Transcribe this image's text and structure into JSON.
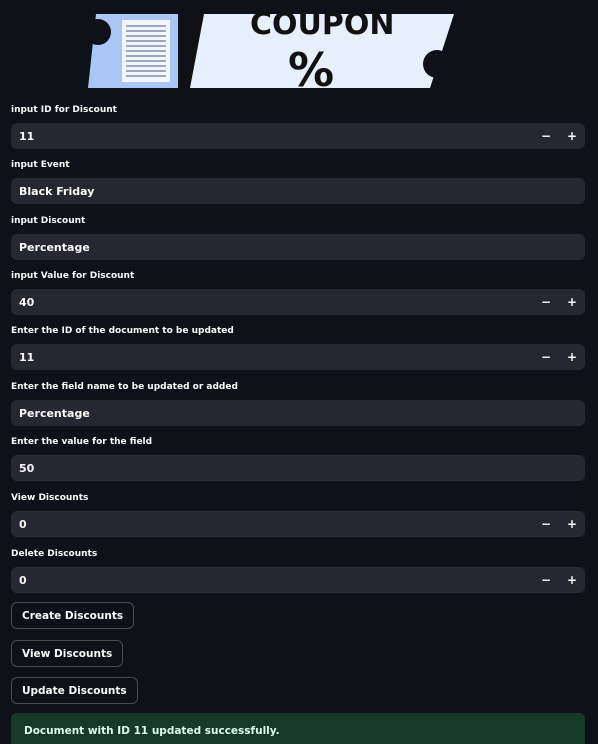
{
  "banner": {
    "coupon_text": "COUPON",
    "percent_symbol": "%"
  },
  "fields": [
    {
      "label": "input ID for Discount",
      "value": "11",
      "stepper": true
    },
    {
      "label": "input Event",
      "value": "Black Friday",
      "stepper": false
    },
    {
      "label": "input Discount",
      "value": "Percentage",
      "stepper": false
    },
    {
      "label": "input Value for Discount",
      "value": "40",
      "stepper": true
    },
    {
      "label": "Enter the ID of the document to be updated",
      "value": "11",
      "stepper": true
    },
    {
      "label": "Enter the field name to be updated or added",
      "value": "Percentage",
      "stepper": false
    },
    {
      "label": "Enter the value for the field",
      "value": "50",
      "stepper": false
    },
    {
      "label": "View Discounts",
      "value": "0",
      "stepper": true
    },
    {
      "label": "Delete Discounts",
      "value": "0",
      "stepper": true
    }
  ],
  "stepper": {
    "minus": "−",
    "plus": "+"
  },
  "buttons": {
    "create": "Create Discounts",
    "view": "View Discounts",
    "update": "Update Discounts"
  },
  "alert": {
    "message": "Document with ID 11 updated successfully."
  },
  "colors": {
    "background": "#0e1117",
    "input_bg": "#262730",
    "success_bg": "#173928",
    "success_text": "#dffde9"
  }
}
